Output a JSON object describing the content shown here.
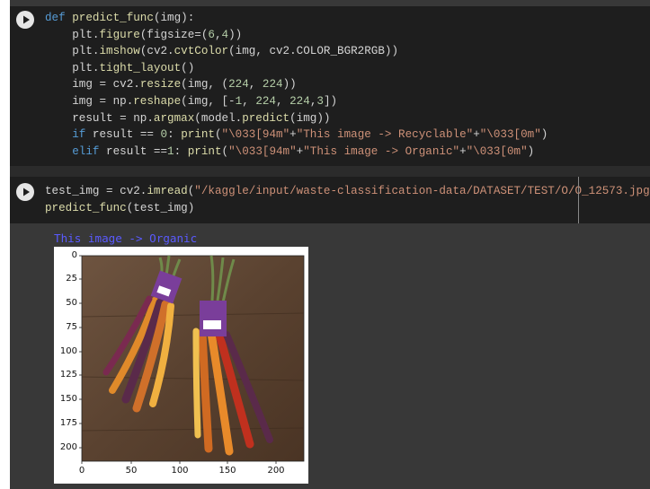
{
  "cell1": {
    "lines": [
      [
        {
          "t": "def ",
          "c": "kw"
        },
        {
          "t": "predict_func",
          "c": "fn"
        },
        {
          "t": "(img):",
          "c": ""
        }
      ],
      [
        {
          "t": "    plt.",
          "c": ""
        },
        {
          "t": "figure",
          "c": "fn"
        },
        {
          "t": "(figsize=(",
          "c": ""
        },
        {
          "t": "6",
          "c": "num"
        },
        {
          "t": ",",
          "c": ""
        },
        {
          "t": "4",
          "c": "num"
        },
        {
          "t": "))",
          "c": ""
        }
      ],
      [
        {
          "t": "    plt.",
          "c": ""
        },
        {
          "t": "imshow",
          "c": "fn"
        },
        {
          "t": "(cv2.",
          "c": ""
        },
        {
          "t": "cvtColor",
          "c": "fn"
        },
        {
          "t": "(img, cv2.COLOR_BGR2RGB))",
          "c": ""
        }
      ],
      [
        {
          "t": "    plt.",
          "c": ""
        },
        {
          "t": "tight_layout",
          "c": "fn"
        },
        {
          "t": "()",
          "c": ""
        }
      ],
      [
        {
          "t": "    img = cv2.",
          "c": ""
        },
        {
          "t": "resize",
          "c": "fn"
        },
        {
          "t": "(img, (",
          "c": ""
        },
        {
          "t": "224",
          "c": "num"
        },
        {
          "t": ", ",
          "c": ""
        },
        {
          "t": "224",
          "c": "num"
        },
        {
          "t": "))",
          "c": ""
        }
      ],
      [
        {
          "t": "    img = np.",
          "c": ""
        },
        {
          "t": "reshape",
          "c": "fn"
        },
        {
          "t": "(img, [-",
          "c": ""
        },
        {
          "t": "1",
          "c": "num"
        },
        {
          "t": ", ",
          "c": ""
        },
        {
          "t": "224",
          "c": "num"
        },
        {
          "t": ", ",
          "c": ""
        },
        {
          "t": "224",
          "c": "num"
        },
        {
          "t": ",",
          "c": ""
        },
        {
          "t": "3",
          "c": "num"
        },
        {
          "t": "])",
          "c": ""
        }
      ],
      [
        {
          "t": "    result = np.",
          "c": ""
        },
        {
          "t": "argmax",
          "c": "fn"
        },
        {
          "t": "(model.",
          "c": ""
        },
        {
          "t": "predict",
          "c": "fn"
        },
        {
          "t": "(img))",
          "c": ""
        }
      ],
      [
        {
          "t": "    ",
          "c": ""
        },
        {
          "t": "if",
          "c": "kw"
        },
        {
          "t": " result == ",
          "c": ""
        },
        {
          "t": "0",
          "c": "num"
        },
        {
          "t": ": ",
          "c": ""
        },
        {
          "t": "print",
          "c": "fn"
        },
        {
          "t": "(",
          "c": ""
        },
        {
          "t": "\"\\033[94m\"",
          "c": "str"
        },
        {
          "t": "+",
          "c": ""
        },
        {
          "t": "\"This image -> Recyclable\"",
          "c": "str"
        },
        {
          "t": "+",
          "c": ""
        },
        {
          "t": "\"\\033[0m\"",
          "c": "str"
        },
        {
          "t": ")",
          "c": ""
        }
      ],
      [
        {
          "t": "    ",
          "c": ""
        },
        {
          "t": "elif",
          "c": "kw"
        },
        {
          "t": " result ==",
          "c": ""
        },
        {
          "t": "1",
          "c": "num"
        },
        {
          "t": ": ",
          "c": ""
        },
        {
          "t": "print",
          "c": "fn"
        },
        {
          "t": "(",
          "c": ""
        },
        {
          "t": "\"\\033[94m\"",
          "c": "str"
        },
        {
          "t": "+",
          "c": ""
        },
        {
          "t": "\"This image -> Organic\"",
          "c": "str"
        },
        {
          "t": "+",
          "c": ""
        },
        {
          "t": "\"\\033[0m\"",
          "c": "str"
        },
        {
          "t": ")",
          "c": ""
        }
      ]
    ]
  },
  "cell2": {
    "lines": [
      [
        {
          "t": "test_img = cv2.",
          "c": ""
        },
        {
          "t": "imread",
          "c": "fn"
        },
        {
          "t": "(",
          "c": ""
        },
        {
          "t": "\"/kaggle/input/waste-classification-data/DATASET/TEST/O/O_12573.jpg\"",
          "c": "str"
        },
        {
          "t": ")",
          "c": ""
        }
      ],
      [
        {
          "t": "predict_func",
          "c": "fn"
        },
        {
          "t": "(test_img)",
          "c": ""
        }
      ]
    ]
  },
  "output": {
    "text": "This image -> Organic"
  },
  "figure": {
    "y_ticks": [
      "0",
      "25",
      "50",
      "75",
      "100",
      "125",
      "150",
      "175",
      "200"
    ],
    "x_ticks": [
      "0",
      "50",
      "100",
      "150",
      "200"
    ],
    "image_subject": "bunch of multicolored carrots on wooden table"
  },
  "colors": {
    "cell_bg": "#1e1e1e",
    "output_bg": "#383838",
    "keyword": "#569cd6",
    "function": "#dcdcaa",
    "string": "#ce9178",
    "number": "#b5cea8",
    "output_text": "#5a5aff"
  },
  "icons": {
    "run": "play-circle-icon"
  }
}
